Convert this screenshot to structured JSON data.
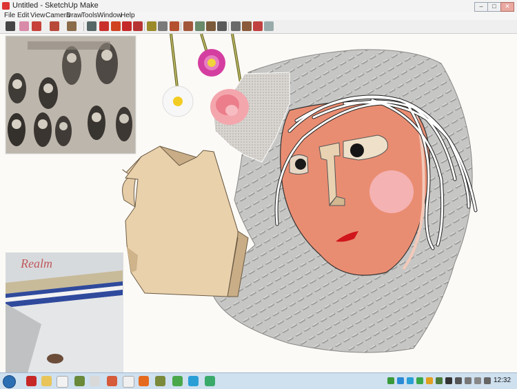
{
  "window": {
    "title": "Untitled - SketchUp Make"
  },
  "window_controls": {
    "minimize": "–",
    "maximize": "□",
    "close": "✕"
  },
  "menu": [
    "File",
    "Edit",
    "View",
    "Camera",
    "Draw",
    "Tools",
    "Window",
    "Help"
  ],
  "toolbar": {
    "tools": [
      "select-tool",
      "eraser-tool",
      "freehand-tool",
      "arc-tool",
      "rectangle-tool",
      "paint-tool",
      "orbit-tool",
      "pan-tool",
      "move-tool",
      "rotate-tool",
      "scale-tool",
      "push-pull-tool",
      "offset-tool",
      "tape-measure-tool",
      "text-tool",
      "axes-tool",
      "position-camera-tool",
      "walk-tool",
      "look-around-tool",
      "zoom-extents-tool",
      "section-plane-tool",
      "components-tool",
      "materials-tool",
      "styles-tool"
    ]
  },
  "canvas": {
    "photo_bottom_handwriting": "Realm",
    "model_description": "collage face with chain-mail hood, flowers and hand"
  },
  "taskbar": {
    "apps": [
      "file-explorer",
      "sketchup",
      "chrome",
      "windows-explorer",
      "photo-viewer",
      "app-6",
      "chrome-2",
      "firefox",
      "app-9",
      "app-10",
      "telegram",
      "shield"
    ],
    "clock": "12:32"
  },
  "colors": {
    "face": "#e98d72",
    "hood": "#bdbdbb",
    "hand": "#ead2ad",
    "taskbar": "#cfe0ef"
  }
}
